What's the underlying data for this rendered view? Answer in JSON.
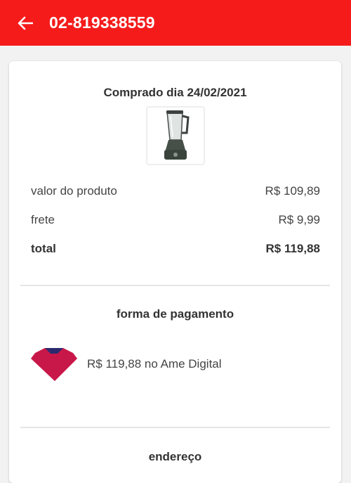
{
  "header": {
    "order_id": "02-819338559",
    "back_icon": "arrow-left-icon",
    "background_color": "#f51b1b"
  },
  "order": {
    "purchase_date": "Comprado dia 24/02/2021",
    "product_image": "blender-icon",
    "lines": [
      {
        "label": "valor do produto",
        "value": "R$ 109,89"
      },
      {
        "label": "frete",
        "value": "R$ 9,99"
      },
      {
        "label": "total",
        "value": "R$ 119,88"
      }
    ]
  },
  "payment": {
    "title": "forma de pagamento",
    "method_icon": "ame-digital-logo-icon",
    "text": "R$ 119,88 no Ame Digital"
  },
  "address": {
    "title": "endereço"
  }
}
